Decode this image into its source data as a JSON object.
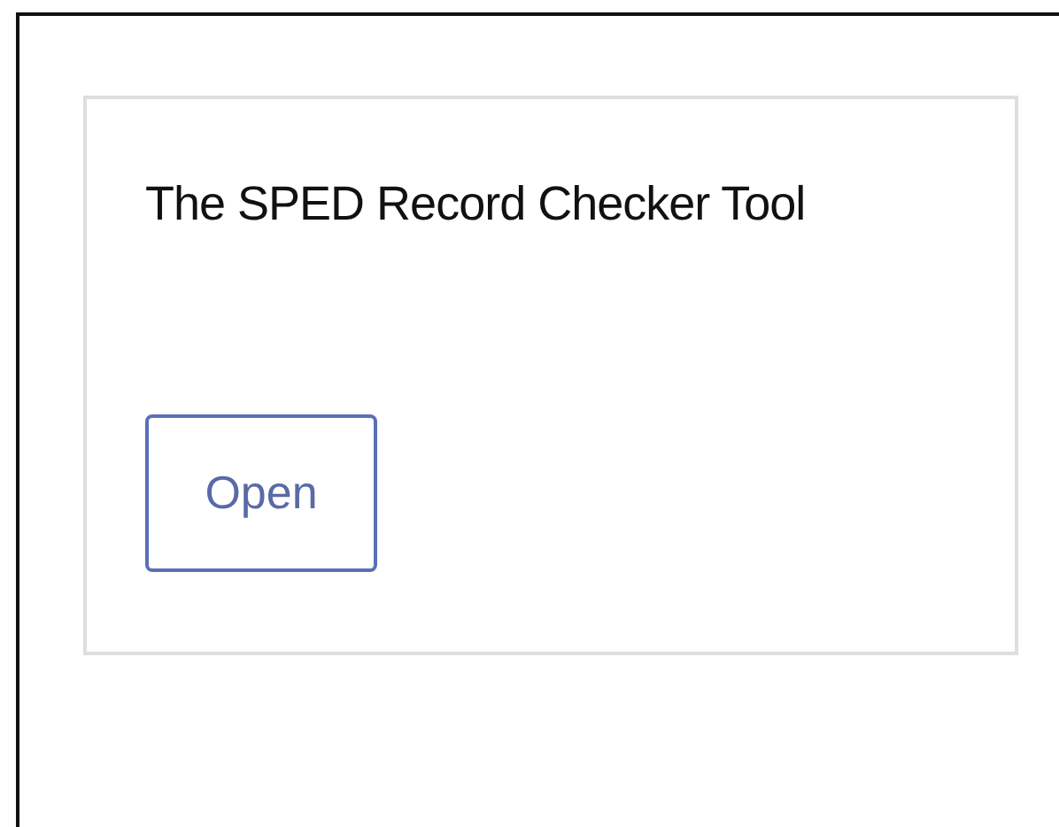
{
  "card": {
    "title": "The SPED Record Checker Tool",
    "button": "Open"
  }
}
